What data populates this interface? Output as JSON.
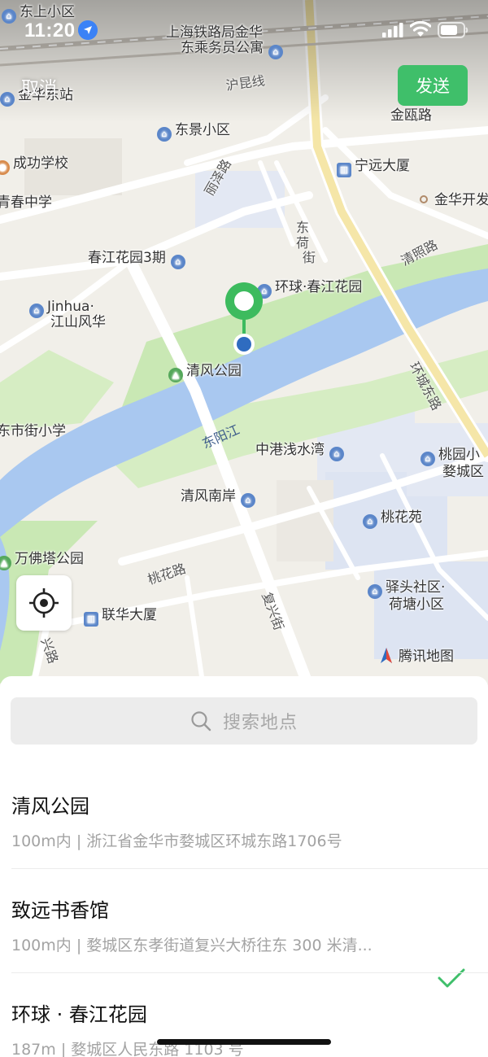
{
  "status_bar": {
    "time": "11:20",
    "location_icon": "location-arrow-icon",
    "signal_icon": "cellular-signal-icon",
    "wifi_icon": "wifi-icon",
    "battery_icon": "battery-icon"
  },
  "nav": {
    "cancel_label": "取消",
    "send_label": "发送"
  },
  "colors": {
    "accent_green": "#3fbf6a",
    "pin_green": "#3dbb5e",
    "pin_blue": "#2f6cc0",
    "river_blue": "#a9c8f0",
    "park_green": "#c9e8b4",
    "check_green": "#3fbf6a"
  },
  "map": {
    "pois": [
      {
        "id": "dongshang",
        "text": "东上小区",
        "type": "residential"
      },
      {
        "id": "railway-office",
        "text": "上海铁路局金华",
        "type": "none"
      },
      {
        "id": "railway-office-2",
        "text": "东乘务员公寓",
        "type": "residential"
      },
      {
        "id": "jinhua-east-station",
        "text": "金华东站",
        "type": "residential"
      },
      {
        "id": "dongjing",
        "text": "东景小区",
        "type": "residential"
      },
      {
        "id": "jinou-road",
        "text": "金瓯路",
        "type": "road"
      },
      {
        "id": "chenggong-school",
        "text": "成功学校",
        "type": "school"
      },
      {
        "id": "ningyuan",
        "text": "宁远大厦",
        "type": "office"
      },
      {
        "id": "qingchun-school",
        "text": "青春中学",
        "type": "school"
      },
      {
        "id": "jinhua-kaifa",
        "text": "金华开发",
        "type": "dot"
      },
      {
        "id": "chunjiang-3",
        "text": "春江花园3期",
        "type": "residential"
      },
      {
        "id": "huanqiu-chunjiang",
        "text": "环球·春江花园",
        "type": "residential"
      },
      {
        "id": "jinhua-jiangshan",
        "text": "Jinhua·",
        "type": "residential"
      },
      {
        "id": "jinhua-jiangshan-2",
        "text": "江山风华",
        "type": "none"
      },
      {
        "id": "qingfeng-park",
        "text": "清风公园",
        "type": "park"
      },
      {
        "id": "dongshi-school",
        "text": "东市街小学",
        "type": "none"
      },
      {
        "id": "zhonggang",
        "text": "中港浅水湾",
        "type": "residential"
      },
      {
        "id": "taoyuan",
        "text": "桃园小",
        "type": "residential"
      },
      {
        "id": "taoyuan-2",
        "text": "婺城区",
        "type": "none"
      },
      {
        "id": "qingfeng-south",
        "text": "清风南岸",
        "type": "residential"
      },
      {
        "id": "taohuayuan",
        "text": "桃花苑",
        "type": "residential"
      },
      {
        "id": "wanfota",
        "text": "万佛塔公园",
        "type": "park"
      },
      {
        "id": "yitou",
        "text": "驿头社区·",
        "type": "residential"
      },
      {
        "id": "yitou-2",
        "text": "荷塘小区",
        "type": "none"
      },
      {
        "id": "lianhua",
        "text": "联华大厦",
        "type": "office"
      }
    ],
    "roads": [
      {
        "id": "hushang-line",
        "text": "沪昆线"
      },
      {
        "id": "liyang-road",
        "text": "丽泽路"
      },
      {
        "id": "dongsha-street",
        "text": "东"
      },
      {
        "id": "dongsha-street-2",
        "text": "荷"
      },
      {
        "id": "dongsha-street-3",
        "text": "街"
      },
      {
        "id": "qingzhao-road",
        "text": "清照路"
      },
      {
        "id": "huancheng-east",
        "text": "环城东路"
      },
      {
        "id": "taohua-road",
        "text": "桃花路"
      },
      {
        "id": "fuxing-street",
        "text": "复兴街"
      },
      {
        "id": "bottom-left-road",
        "text": "兴路"
      }
    ],
    "river_name": "东阳江",
    "brand_text": "腾讯地图",
    "locate_icon": "locate-crosshair-icon"
  },
  "search": {
    "placeholder": "搜索地点",
    "icon": "search-icon"
  },
  "places": [
    {
      "name": "清风公园",
      "desc": "100m内 | 浙江省金华市婺城区环城东路1706号",
      "selected": false
    },
    {
      "name": "致远书香馆",
      "desc": "100m内 | 婺城区东孝街道复兴大桥往东 300 米清...",
      "selected": true
    },
    {
      "name": "环球 · 春江花园",
      "desc": "187m | 婺城区人民东路 1103 号",
      "selected": false
    }
  ]
}
